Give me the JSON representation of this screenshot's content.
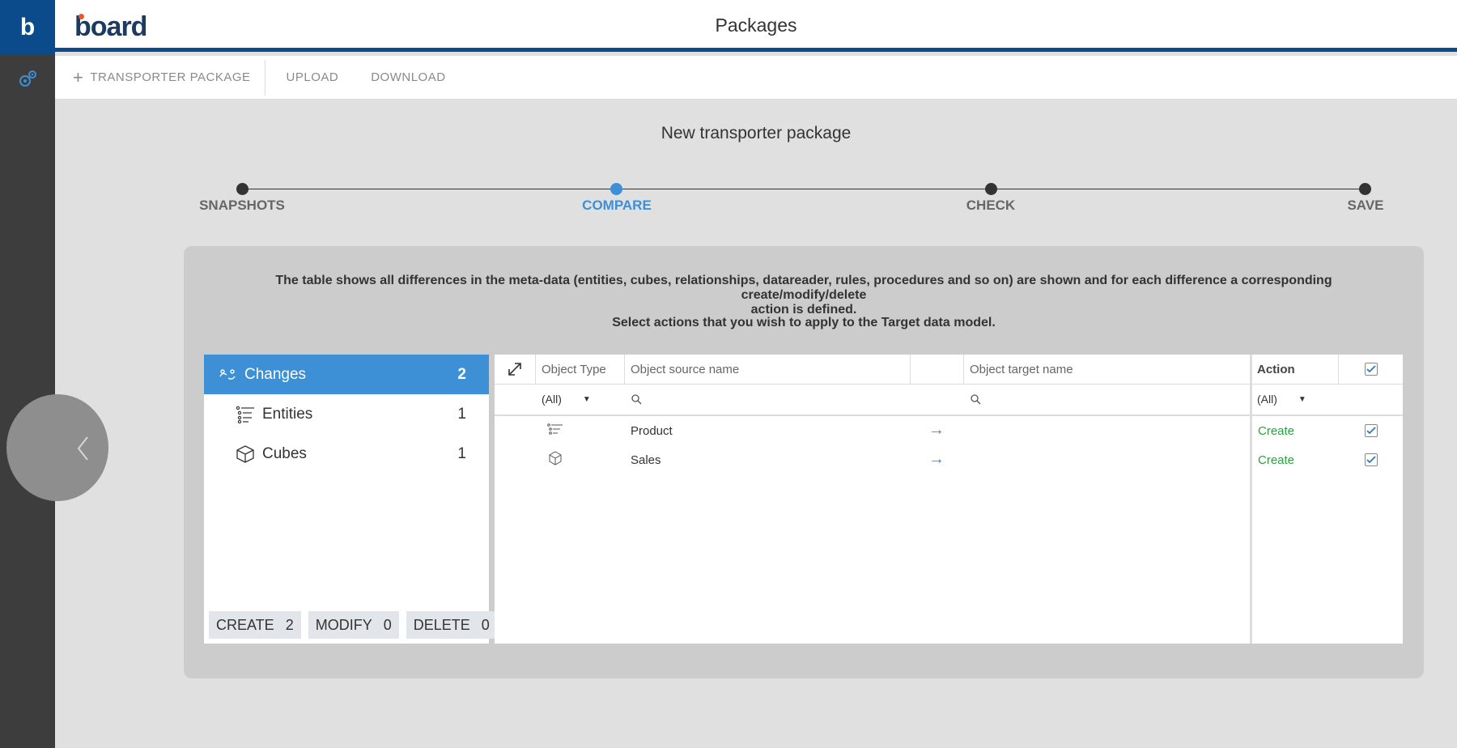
{
  "app": {
    "rail_logo_letter": "b",
    "brand_name": "board",
    "page_title": "Packages"
  },
  "toolbar": {
    "new_package_label": "TRANSPORTER PACKAGE",
    "upload_label": "UPLOAD",
    "download_label": "DOWNLOAD"
  },
  "wizard": {
    "title": "New transporter package",
    "steps": [
      {
        "label": "SNAPSHOTS",
        "active": false
      },
      {
        "label": "COMPARE",
        "active": true
      },
      {
        "label": "CHECK",
        "active": false
      },
      {
        "label": "SAVE",
        "active": false
      }
    ]
  },
  "panel": {
    "description_line1": "The table shows all differences in the meta-data (entities, cubes, relationships, datareader, rules, procedures and so on) are shown and for each difference a corresponding create/modify/delete",
    "description_line2": "action is defined.",
    "instruction": "Select actions that you wish to apply to the Target data model."
  },
  "sidelist": {
    "items": [
      {
        "label": "Changes",
        "count": "2",
        "icon": "changes-icon",
        "active": true
      },
      {
        "label": "Entities",
        "count": "1",
        "icon": "entities-icon",
        "active": false
      },
      {
        "label": "Cubes",
        "count": "1",
        "icon": "cube-icon",
        "active": false
      }
    ],
    "summary": [
      {
        "label": "CREATE",
        "count": "2"
      },
      {
        "label": "MODIFY",
        "count": "0"
      },
      {
        "label": "DELETE",
        "count": "0"
      }
    ]
  },
  "grid": {
    "headers": {
      "object_type": "Object Type",
      "source_name": "Object source name",
      "target_name": "Object target name",
      "action": "Action"
    },
    "filters": {
      "type_value": "(All)",
      "action_value": "(All)"
    },
    "rows": [
      {
        "type_icon": "entities-icon",
        "source": "Product",
        "target": "",
        "action": "Create",
        "checked": true
      },
      {
        "type_icon": "cube-icon",
        "source": "Sales",
        "target": "",
        "action": "Create",
        "checked": true
      }
    ]
  },
  "colors": {
    "accent": "#3d8fd6",
    "brand": "#0b4a8b",
    "create": "#2ea043",
    "rail": "#3d3d3d"
  }
}
